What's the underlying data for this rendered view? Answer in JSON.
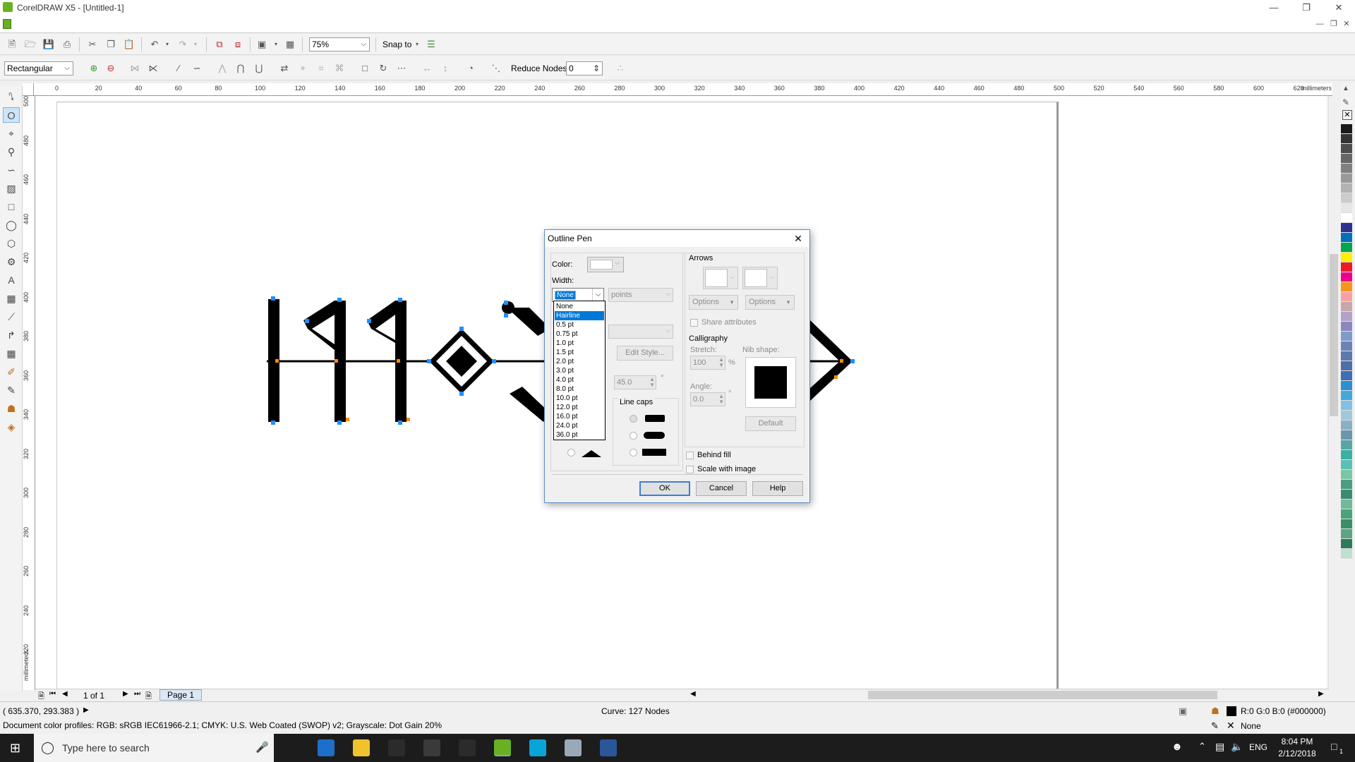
{
  "window": {
    "title": "CorelDRAW X5 - [Untitled-1]"
  },
  "toolbar1": {
    "zoom": "75%",
    "snap_to": "Snap to"
  },
  "toolbar2": {
    "shape_mode": "Rectangular",
    "reduce_nodes_label": "Reduce Nodes",
    "reduce_nodes_value": "0"
  },
  "rulers": {
    "h_ticks": [
      "0",
      "20",
      "40",
      "60",
      "80",
      "100",
      "120",
      "140",
      "160",
      "180",
      "200",
      "220",
      "240",
      "260",
      "280",
      "300",
      "320",
      "340",
      "360",
      "380",
      "400",
      "420",
      "440",
      "460",
      "480",
      "500",
      "520",
      "540",
      "560",
      "580",
      "600",
      "620"
    ],
    "h_units": "millimeters",
    "v_ticks": [
      "500",
      "480",
      "460",
      "440",
      "420",
      "400",
      "380",
      "360",
      "340",
      "320",
      "300",
      "280",
      "260",
      "240",
      "220"
    ],
    "v_units": "millimeters"
  },
  "page_bar": {
    "page_count": "1 of 1",
    "page_tab": "Page 1"
  },
  "status": {
    "coords": "( 635.370, 293.383 )",
    "object_info": "Curve: 127 Nodes",
    "profiles": "Document color profiles: RGB: sRGB IEC61966-2.1; CMYK: U.S. Web Coated (SWOP) v2; Grayscale: Dot Gain 20%",
    "fill_info": "R:0 G:0 B:0 (#000000)",
    "outline_info": "None"
  },
  "taskbar": {
    "search_placeholder": "Type here to search",
    "lang": "ENG",
    "time": "8:04 PM",
    "date": "2/12/2018",
    "notif_count": "1"
  },
  "dialog": {
    "title": "Outline Pen",
    "color_label": "Color:",
    "width_label": "Width:",
    "width_value": "None",
    "units_value": "points",
    "edit_style": "Edit Style...",
    "angle_value": "45.0",
    "degree": "°",
    "line_caps_label": "Line caps",
    "arrows_label": "Arrows",
    "options1": "Options",
    "options2": "Options",
    "share_attributes": "Share attributes",
    "calligraphy_label": "Calligraphy",
    "stretch_label": "Stretch:",
    "stretch_value": "100",
    "percent": "%",
    "nib_label": "Nib shape:",
    "angle_label": "Angle:",
    "callig_angle_value": "0.0",
    "default_btn": "Default",
    "behind_fill": "Behind fill",
    "scale_with_image": "Scale with image",
    "ok": "OK",
    "cancel": "Cancel",
    "help": "Help"
  },
  "width_options": [
    "None",
    "Hairline",
    "0.5 pt",
    "0.75 pt",
    "1.0 pt",
    "1.5 pt",
    "2.0 pt",
    "3.0 pt",
    "4.0 pt",
    "8.0 pt",
    "10.0 pt",
    "12.0 pt",
    "16.0 pt",
    "24.0 pt",
    "36.0 pt"
  ],
  "width_selected_index": 1,
  "palette_colors": [
    "#1a1a1a",
    "#333333",
    "#4d4d4d",
    "#666666",
    "#808080",
    "#999999",
    "#b3b3b3",
    "#cccccc",
    "#e6e6e6",
    "#ffffff",
    "#2e3192",
    "#0072bc",
    "#00a651",
    "#fff200",
    "#ed1c24",
    "#ec008c",
    "#f7941d",
    "#f9a1a1",
    "#c6a8a8",
    "#b3a2c7",
    "#8c87c1",
    "#7e9bcc",
    "#6c83b6",
    "#5a7ab0",
    "#4d6fa5",
    "#3e6eb3",
    "#2b8fd1",
    "#43a9d8",
    "#7fc2e3",
    "#9fc9d6",
    "#88b1c5",
    "#6a98ab",
    "#56a7a3",
    "#3ab0a3",
    "#5cbfb4",
    "#7ac7a5",
    "#4c9d82",
    "#3d8a72",
    "#73b89a",
    "#4aa37a",
    "#3b8f68",
    "#5aa684",
    "#2d7a58",
    "#bde0d0"
  ],
  "taskbar_icons": [
    {
      "name": "task-view-icon",
      "color": "#1c1c1c"
    },
    {
      "name": "edge-icon",
      "color": "#1e6fc9"
    },
    {
      "name": "file-explorer-icon",
      "color": "#f2c12e"
    },
    {
      "name": "store-icon",
      "color": "#2b2b2b"
    },
    {
      "name": "photos-icon",
      "color": "#3a3a3a"
    },
    {
      "name": "mail-icon",
      "color": "#2b2b2b"
    },
    {
      "name": "coreldraw-icon",
      "color": "#6ab023"
    },
    {
      "name": "corel-connect-icon",
      "color": "#0aa5d8"
    },
    {
      "name": "chrome-like-icon",
      "color": "#9aa9b8"
    },
    {
      "name": "word-icon",
      "color": "#2b579a"
    }
  ]
}
